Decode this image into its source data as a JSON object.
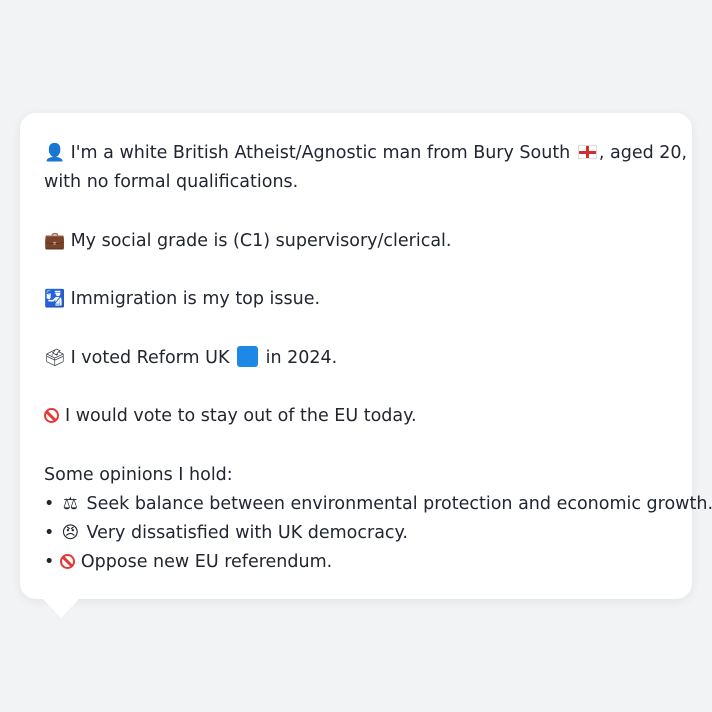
{
  "profile": {
    "intro_pre_flag": "I'm a white British Atheist/Agnostic man from Bury South",
    "intro_post_flag": ", aged 20,",
    "intro_line2": "with no formal qualifications.",
    "social_grade": "My social grade is (C1) supervisory/clerical.",
    "top_issue": "Immigration is my top issue.",
    "vote_pre": "I voted Reform UK",
    "vote_post": "in 2024.",
    "eu_vote": "I would vote to stay out of the EU today.",
    "opinions_heading": "Some opinions I hold:",
    "opinions": [
      "Seek balance between environmental protection and economic growth.",
      "Very dissatisfied with UK democracy.",
      "Oppose new EU referendum."
    ],
    "bullet": "•"
  },
  "icons": {
    "person": "person-silhouette-icon",
    "flag": "england-flag-icon",
    "briefcase": "briefcase-icon",
    "passport": "passport-control-icon",
    "ballot": "ballot-box-icon",
    "blue_square": "blue-square-icon",
    "no_entry": "prohibited-icon",
    "scales": "balance-scale-icon",
    "angry": "angry-face-icon"
  },
  "colors": {
    "background": "#f2f3f5",
    "card": "#ffffff",
    "text": "#222630",
    "reform_blue": "#1e88e5",
    "prohibited_red": "#e53935"
  }
}
